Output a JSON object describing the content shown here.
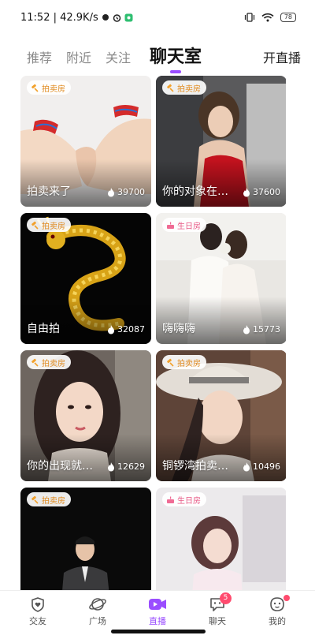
{
  "status_bar": {
    "time_speed": "11:52 | 42.9K/s",
    "battery": "78"
  },
  "tabs": [
    {
      "label": "推荐"
    },
    {
      "label": "附近"
    },
    {
      "label": "关注"
    },
    {
      "label": "聊天室"
    }
  ],
  "top_right": {
    "label": "开直播"
  },
  "cards": [
    {
      "badge": "拍卖房",
      "badge_type": "auction",
      "title": "拍卖来了",
      "count": "39700"
    },
    {
      "badge": "拍卖房",
      "badge_type": "auction",
      "title": "你的对象在…",
      "count": "37600"
    },
    {
      "badge": "拍卖房",
      "badge_type": "auction",
      "title": "自由拍",
      "count": "32087"
    },
    {
      "badge": "生日房",
      "badge_type": "birthday",
      "title": "嗨嗨嗨",
      "count": "15773"
    },
    {
      "badge": "拍卖房",
      "badge_type": "auction",
      "title": "你的出现就…",
      "count": "12629"
    },
    {
      "badge": "拍卖房",
      "badge_type": "auction",
      "title": "铜锣湾拍卖…",
      "count": "10496"
    },
    {
      "badge": "拍卖房",
      "badge_type": "auction",
      "title": "",
      "count": ""
    },
    {
      "badge": "生日房",
      "badge_type": "birthday",
      "title": "",
      "count": ""
    }
  ],
  "bottom_nav": [
    {
      "label": "交友",
      "icon": "heart-icon"
    },
    {
      "label": "广场",
      "icon": "planet-icon"
    },
    {
      "label": "直播",
      "icon": "live-camera-icon"
    },
    {
      "label": "聊天",
      "icon": "chat-bubble-icon",
      "badge": "5"
    },
    {
      "label": "我的",
      "icon": "profile-icon"
    }
  ],
  "colors": {
    "accent": "#9a4dff",
    "auction_badge": "#e08a1e",
    "birthday_badge": "#e85a86",
    "notify": "#ff4b6e"
  }
}
